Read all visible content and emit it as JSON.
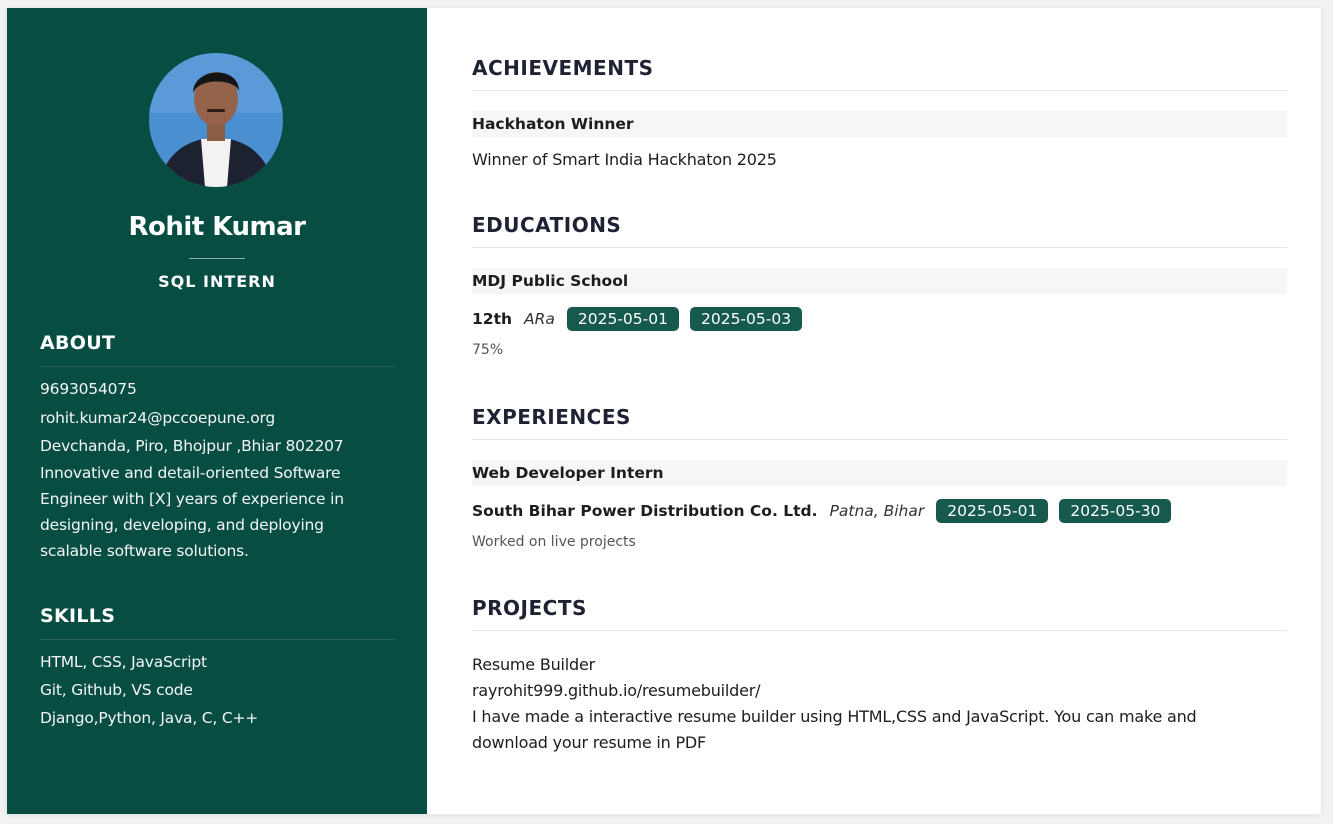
{
  "profile": {
    "name": "Rohit Kumar",
    "role": "SQL INTERN"
  },
  "about": {
    "heading": "ABOUT",
    "phone": "9693054075",
    "email": "rohit.kumar24@pccoepune.org",
    "address": "Devchanda, Piro, Bhojpur ,Bhiar 802207",
    "summary_lines": [
      "Innovative and detail-oriented Software",
      "Engineer with [X] years of experience in",
      "designing, developing, and deploying",
      "scalable software solutions."
    ]
  },
  "skills": {
    "heading": "SKILLS",
    "items": [
      "HTML, CSS, JavaScript",
      "Git, Github, VS code",
      "Django,Python, Java, C, C++"
    ]
  },
  "achievements": {
    "heading": "ACHIEVEMENTS",
    "items": [
      {
        "title": "Hackhaton Winner",
        "description": "Winner of Smart India Hackhaton 2025"
      }
    ]
  },
  "educations": {
    "heading": "EDUCATIONS",
    "items": [
      {
        "school": "MDJ Public School",
        "level": "12th",
        "place": "ARa",
        "start": "2025-05-01",
        "end": "2025-05-03",
        "score": "75%"
      }
    ]
  },
  "experiences": {
    "heading": "EXPERIENCES",
    "items": [
      {
        "title": "Web Developer Intern",
        "company": "South Bihar Power Distribution Co. Ltd.",
        "location": "Patna, Bihar",
        "start": "2025-05-01",
        "end": "2025-05-30",
        "description": "Worked on live projects"
      }
    ]
  },
  "projects": {
    "heading": "PROJECTS",
    "items": [
      {
        "name": "Resume Builder",
        "link": "rayrohit999.github.io/resumebuilder/",
        "description_lines": [
          "I have made a interactive resume builder using HTML,CSS and JavaScript. You can make and",
          "download your resume in PDF"
        ]
      }
    ]
  },
  "colors": {
    "sidebar": "#074d42",
    "pill": "#155a4d",
    "heading_text": "#1f2233"
  }
}
